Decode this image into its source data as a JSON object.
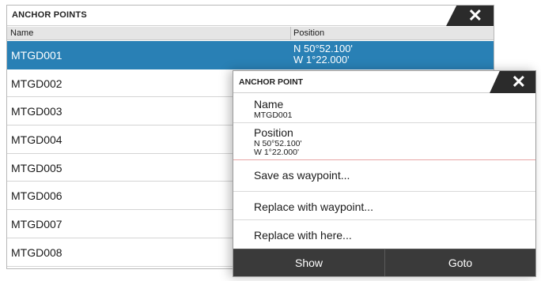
{
  "list": {
    "title": "ANCHOR POINTS",
    "close_glyph": "✕",
    "columns": {
      "name": "Name",
      "position": "Position"
    },
    "rows": [
      {
        "name": "MTGD001",
        "lat": "N  50°52.100'",
        "lon": "W   1°22.000'",
        "selected": true
      },
      {
        "name": "MTGD002",
        "lat": "",
        "lon": ""
      },
      {
        "name": "MTGD003",
        "lat": "",
        "lon": ""
      },
      {
        "name": "MTGD004",
        "lat": "",
        "lon": ""
      },
      {
        "name": "MTGD005",
        "lat": "",
        "lon": ""
      },
      {
        "name": "MTGD006",
        "lat": "",
        "lon": ""
      },
      {
        "name": "MTGD007",
        "lat": "",
        "lon": ""
      },
      {
        "name": "MTGD008",
        "lat": "",
        "lon": ""
      }
    ]
  },
  "dialog": {
    "title": "ANCHOR POINT",
    "close_glyph": "✕",
    "name_label": "Name",
    "name_value": "MTGD001",
    "position_label": "Position",
    "position_lat": "N  50°52.100'",
    "position_lon": "W   1°22.000'",
    "actions": [
      "Save as waypoint...",
      "Replace with waypoint...",
      "Replace with here..."
    ],
    "buttons": {
      "show": "Show",
      "goto": "Goto"
    }
  },
  "colors": {
    "selected_row": "#2980b5",
    "button_bar": "#3a3a3a",
    "title_tab": "#2b2b2b"
  }
}
